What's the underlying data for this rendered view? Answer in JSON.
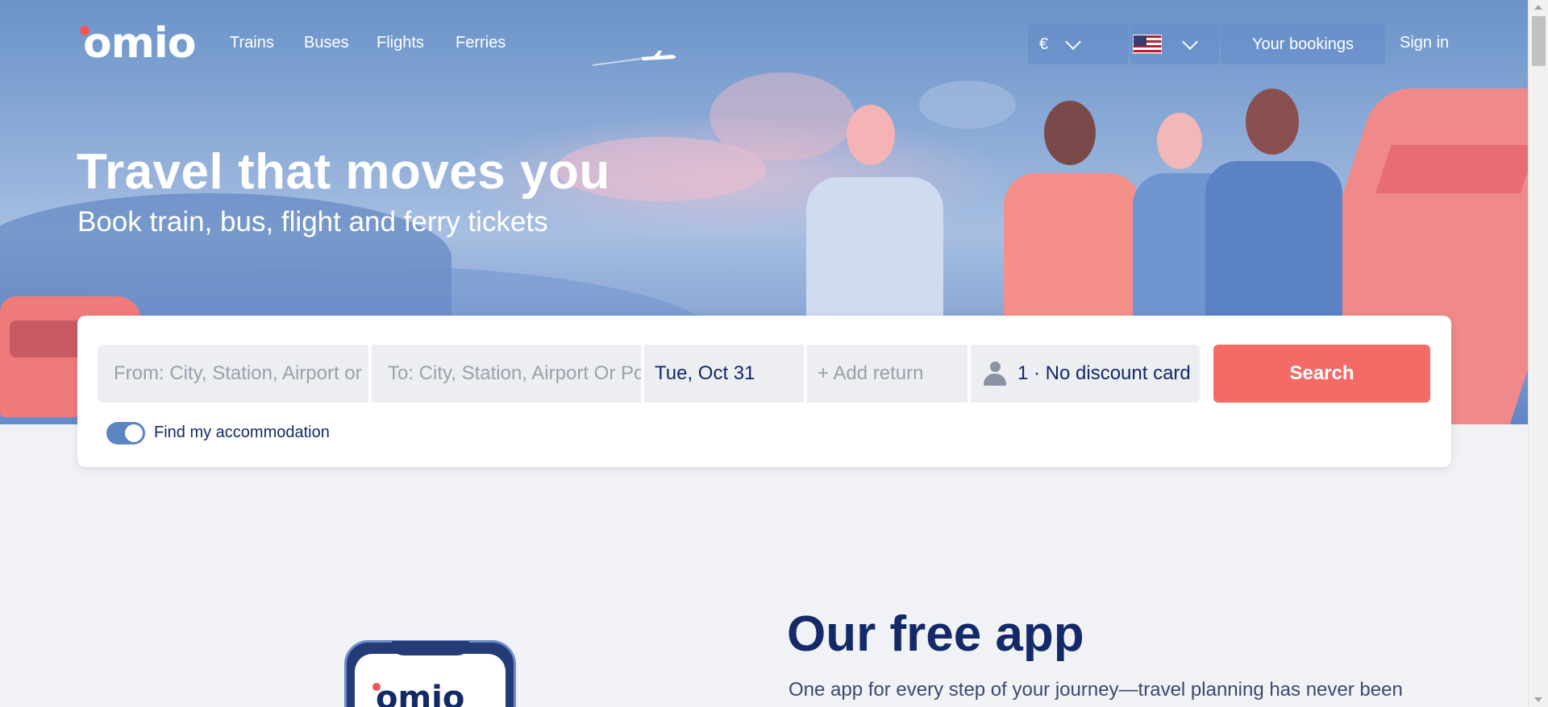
{
  "brand": {
    "logo_text": "omio",
    "accent": "#f2545b",
    "navy": "#132968"
  },
  "nav": {
    "links": [
      "Trains",
      "Buses",
      "Flights",
      "Ferries"
    ],
    "currency": "€",
    "language_icon": "us-flag-icon",
    "bookings_label": "Your bookings",
    "signin_label": "Sign in"
  },
  "hero": {
    "title": "Travel that moves you",
    "subtitle": "Book train, bus, flight and ferry tickets"
  },
  "search": {
    "from_placeholder": "From: City, Station, Airport or Port",
    "to_placeholder": "To: City, Station, Airport Or Port",
    "date_value": "Tue, Oct 31",
    "return_placeholder": "+ Add return",
    "passengers": "1 · No discount card",
    "search_label": "Search",
    "search_color": "#f46b66",
    "accommodation_label": "Find my accommodation",
    "accommodation_enabled": true
  },
  "app_section": {
    "title": "Our free app",
    "description": "One app for every step of your journey—travel planning has never been",
    "phone_logo": "omio"
  }
}
